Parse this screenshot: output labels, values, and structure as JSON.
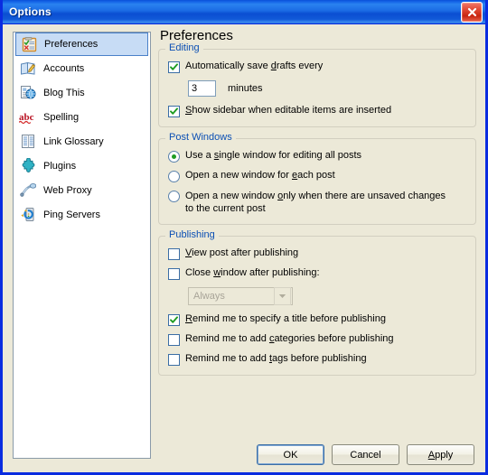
{
  "window": {
    "title": "Options",
    "close_icon": "close-icon"
  },
  "sidebar": {
    "items": [
      {
        "label": "Preferences",
        "icon": "clipboard-checklist-icon",
        "selected": true
      },
      {
        "label": "Accounts",
        "icon": "book-pencil-icon",
        "selected": false
      },
      {
        "label": "Blog This",
        "icon": "document-globe-icon",
        "selected": false
      },
      {
        "label": "Spelling",
        "icon": "abc-spellcheck-icon",
        "selected": false
      },
      {
        "label": "Link Glossary",
        "icon": "list-lines-icon",
        "selected": false
      },
      {
        "label": "Plugins",
        "icon": "puzzle-piece-icon",
        "selected": false
      },
      {
        "label": "Web Proxy",
        "icon": "funnel-pipe-icon",
        "selected": false
      },
      {
        "label": "Ping Servers",
        "icon": "server-refresh-icon",
        "selected": false
      }
    ]
  },
  "pane": {
    "title": "Preferences",
    "editing": {
      "legend": "Editing",
      "autosave": {
        "label_pre": "Automatically save ",
        "label_accel": "d",
        "label_post": "rafts every",
        "checked": true
      },
      "minutes_value": "3",
      "minutes_unit": "minutes",
      "show_sidebar": {
        "label_pre": "",
        "label_accel": "S",
        "label_post": "how sidebar when editable items are inserted",
        "checked": true
      }
    },
    "post_windows": {
      "legend": "Post Windows",
      "options": [
        {
          "pre": "Use a ",
          "accel": "s",
          "post": "ingle window for editing all posts",
          "selected": true
        },
        {
          "pre": "Open a new window for ",
          "accel": "e",
          "post": "ach post",
          "selected": false
        },
        {
          "pre": "Open a new window ",
          "accel": "o",
          "post": "nly when there are unsaved changes to the current post",
          "selected": false
        }
      ]
    },
    "publishing": {
      "legend": "Publishing",
      "view_post": {
        "pre": "",
        "accel": "V",
        "post": "iew post after publishing",
        "checked": false
      },
      "close_window": {
        "pre": "Close ",
        "accel": "w",
        "post": "indow after publishing:",
        "checked": false
      },
      "close_window_select": {
        "value": "Always",
        "disabled": true,
        "arrow_icon": "chevron-down-icon"
      },
      "remind_title": {
        "pre": "",
        "accel": "R",
        "post": "emind me to specify a title before publishing",
        "checked": true
      },
      "remind_categories": {
        "pre": "Remind me to add ",
        "accel": "c",
        "post": "ategories before publishing",
        "checked": false
      },
      "remind_tags": {
        "pre": "Remind me to add ",
        "accel": "t",
        "post": "ags before publishing",
        "checked": false
      }
    }
  },
  "buttons": {
    "ok": {
      "label": "OK",
      "default": true
    },
    "cancel": {
      "label": "Cancel"
    },
    "apply": {
      "pre": "",
      "accel": "A",
      "post": "pply"
    }
  },
  "colors": {
    "titlebar_blue": "#0a50d8",
    "frame_blue": "#0a2ce0",
    "dialog_bg": "#ece9d8",
    "group_legend": "#0b4fb4",
    "selection_bg": "#c7dcf5",
    "selection_border": "#4a80c8",
    "check_green": "#1f9c22",
    "close_red": "#c8240f"
  }
}
